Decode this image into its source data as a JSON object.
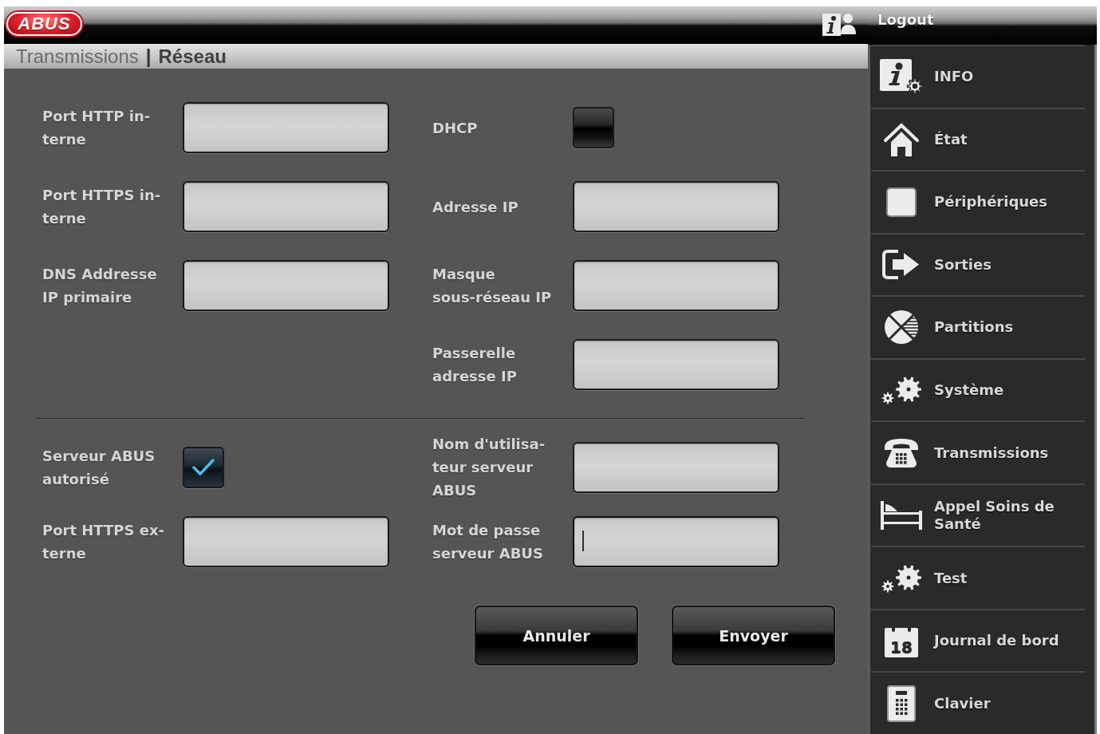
{
  "header": {
    "logo": "ABUS"
  },
  "breadcrumb": {
    "items": [
      {
        "label": "Transmissions",
        "current": false
      },
      {
        "label": "Réseau",
        "current": true
      }
    ],
    "separator": "|"
  },
  "sections": [
    {
      "rows": [
        {
          "left": {
            "kind": "text",
            "label": "Port HTTP in-\nterne",
            "focused": false
          },
          "right": {
            "kind": "checkbox",
            "label": "DHCP",
            "checked": false
          }
        },
        {
          "left": {
            "kind": "text",
            "label": "Port HTTPS in-\nterne",
            "focused": false
          },
          "right": {
            "kind": "text",
            "label": "Adresse IP",
            "focused": false
          }
        },
        {
          "left": {
            "kind": "text",
            "label": "DNS Addresse\nIP primaire",
            "focused": false
          },
          "right": {
            "kind": "text",
            "label": "Masque\nsous-réseau IP",
            "focused": false
          }
        },
        {
          "right": {
            "kind": "text",
            "label": "Passerelle\nadresse IP",
            "focused": false
          }
        }
      ]
    },
    {
      "rows": [
        {
          "left": {
            "kind": "checkbox",
            "label": "Serveur ABUS\nautorisé",
            "checked": true
          },
          "right": {
            "kind": "text",
            "label": "Nom d'utilisa-\nteur serveur\nABUS",
            "focused": false
          }
        },
        {
          "left": {
            "kind": "text",
            "label": "Port HTTPS ex-\nterne",
            "focused": false
          },
          "right": {
            "kind": "password",
            "label": "Mot de passe\nserveur ABUS",
            "focused": true
          }
        }
      ]
    }
  ],
  "buttons": [
    {
      "label": "Annuler"
    },
    {
      "label": "Envoyer"
    }
  ],
  "sidebar": {
    "logout": "Logout",
    "items": [
      {
        "label": "INFO"
      },
      {
        "label": "État"
      },
      {
        "label": "Périphériques"
      },
      {
        "label": "Sorties"
      },
      {
        "label": "Partitions"
      },
      {
        "label": "Système"
      },
      {
        "label": "Transmissions"
      },
      {
        "label": "Appel Soins de Santé"
      },
      {
        "label": "Test"
      },
      {
        "label": "Journal de bord",
        "icon_text": "18"
      },
      {
        "label": "Clavier"
      }
    ]
  }
}
